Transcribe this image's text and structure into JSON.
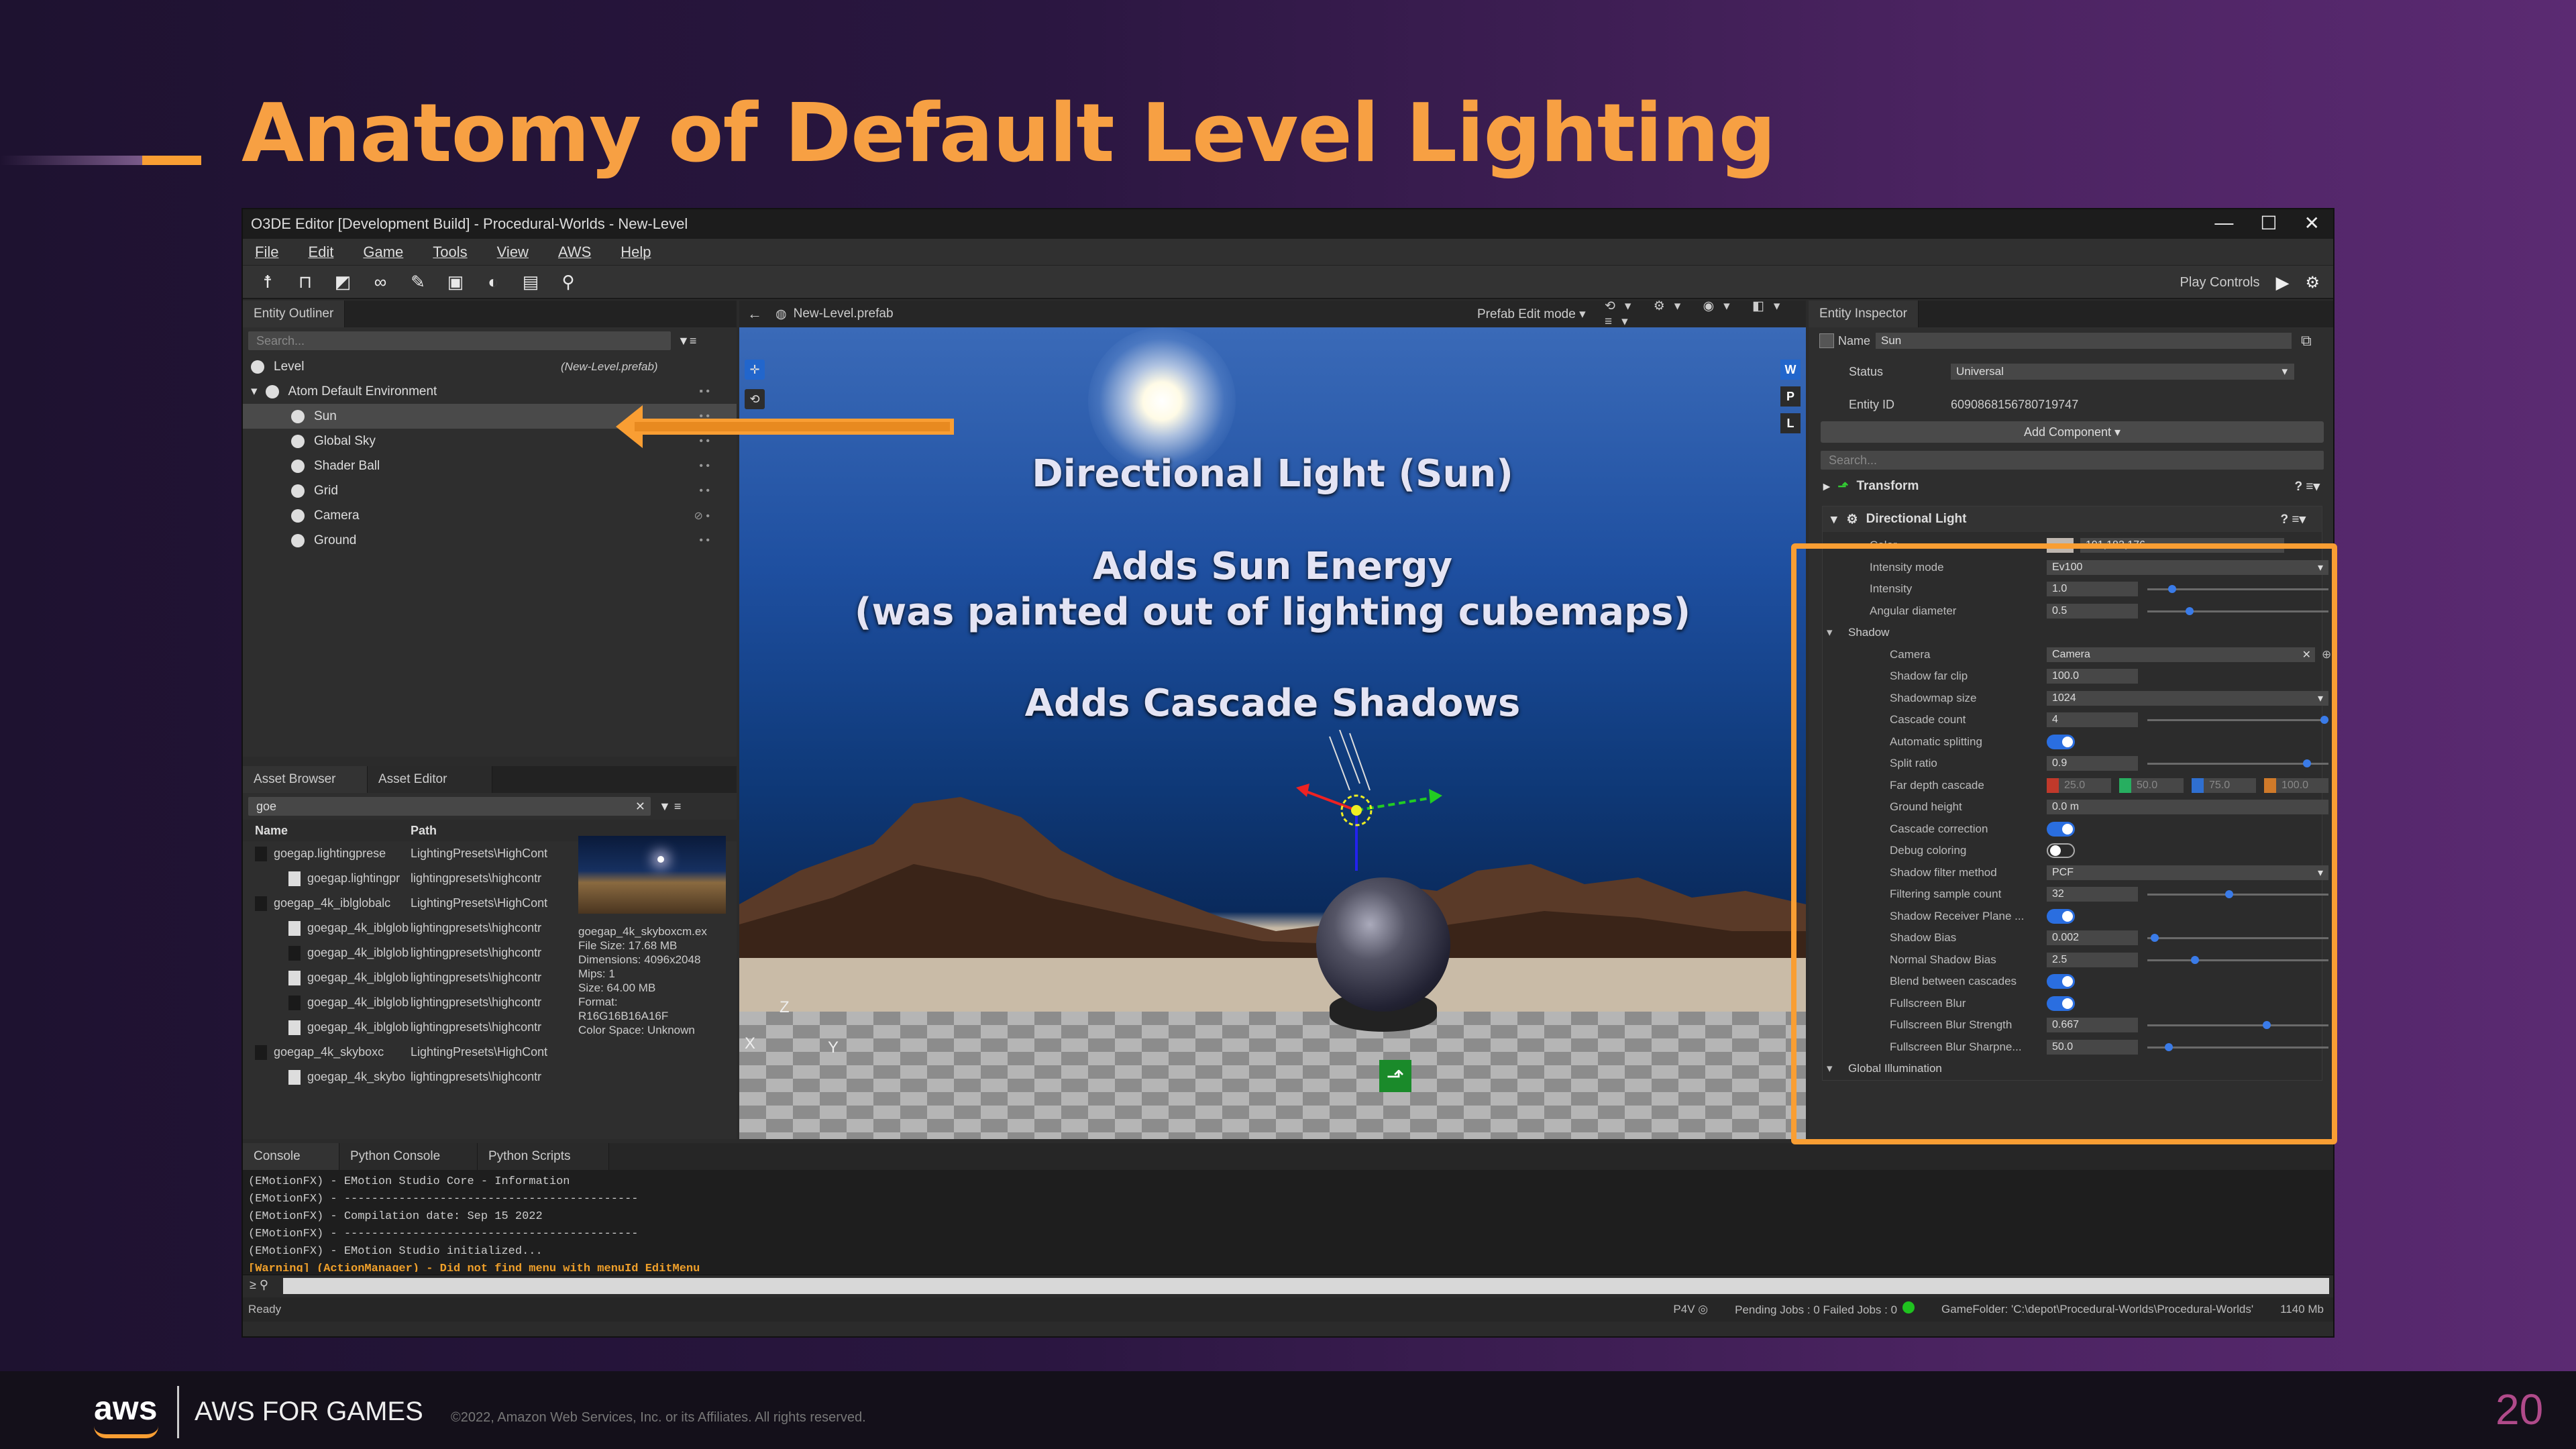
{
  "slide": {
    "title": "Anatomy of Default Level Lighting",
    "footer_brand": "aws",
    "footer_text": "AWS FOR GAMES",
    "copyright": "©2022, Amazon Web Services, Inc. or its Affiliates. All rights reserved.",
    "page_number": "20",
    "accent_color": "#f99e33"
  },
  "window": {
    "title": "O3DE Editor [Development Build] - Procedural-Worlds - New-Level",
    "controls": [
      "—",
      "☐",
      "✕"
    ]
  },
  "menu": [
    "File",
    "Edit",
    "Game",
    "Tools",
    "View",
    "AWS",
    "Help"
  ],
  "toolbar": {
    "play_controls_label": "Play Controls"
  },
  "outliner": {
    "tab": "Entity Outliner",
    "search_placeholder": "Search...",
    "level_label": "Level",
    "level_path": "(New-Level.prefab)",
    "env_label": "Atom Default Environment",
    "items": [
      "Sun",
      "Global Sky",
      "Shader Ball",
      "Grid",
      "Camera",
      "Ground"
    ]
  },
  "asset_browser": {
    "tabs": [
      "Asset Browser",
      "Asset Editor"
    ],
    "search_value": "goe",
    "col_name": "Name",
    "col_path": "Path",
    "rows": [
      {
        "name": "goegap.lightingprese",
        "path": "LightingPresets\\HighCont"
      },
      {
        "name": "goegap.lightingpr",
        "path": "lightingpresets\\highcontr"
      },
      {
        "name": "goegap_4k_iblglobalc",
        "path": "LightingPresets\\HighCont"
      },
      {
        "name": "goegap_4k_iblglob",
        "path": "lightingpresets\\highcontr"
      },
      {
        "name": "goegap_4k_iblglob",
        "path": "lightingpresets\\highcontr"
      },
      {
        "name": "goegap_4k_iblglob",
        "path": "lightingpresets\\highcontr"
      },
      {
        "name": "goegap_4k_iblglob",
        "path": "lightingpresets\\highcontr"
      },
      {
        "name": "goegap_4k_iblglob",
        "path": "lightingpresets\\highcontr"
      },
      {
        "name": "goegap_4k_skyboxc",
        "path": "LightingPresets\\HighCont"
      },
      {
        "name": "goegap_4k_skybo",
        "path": "lightingpresets\\highcontr"
      }
    ],
    "info": [
      "goegap_4k_skyboxcm.ex",
      "File Size: 17.68 MB",
      "Dimensions: 4096x2048",
      "Mips: 1",
      "Size: 64.00 MB",
      "Format:",
      "R16G16B16A16F",
      "Color Space: Unknown"
    ]
  },
  "viewport": {
    "tab": "New-Level.prefab",
    "mode": "Prefab Edit mode",
    "annotations": [
      "Directional Light (Sun)",
      "Adds Sun Energy",
      "(was painted out of lighting cubemaps)",
      "Adds Cascade Shadows"
    ],
    "side_right": [
      "W",
      "P",
      "L"
    ],
    "axis": {
      "z": "Z",
      "x": "X",
      "y": "Y"
    }
  },
  "inspector": {
    "tab": "Entity Inspector",
    "name_label": "Name",
    "name_value": "Sun",
    "status_label": "Status",
    "status_value": "Universal",
    "entity_id_label": "Entity ID",
    "entity_id_value": "6090868156780719747",
    "add_component": "Add Component ▾",
    "search_placeholder": "Search...",
    "transform_label": "Transform",
    "dl_label": "Directional Light",
    "color_value": "191,183,176",
    "fields": {
      "color": "Color",
      "intensity_mode": "Intensity mode",
      "intensity_mode_value": "Ev100",
      "intensity": "Intensity",
      "intensity_value": "1.0",
      "angular": "Angular diameter",
      "angular_value": "0.5",
      "shadow": "Shadow",
      "camera": "Camera",
      "camera_value": "Camera",
      "far_clip": "Shadow far clip",
      "far_clip_value": "100.0",
      "shadowmap_size": "Shadowmap size",
      "shadowmap_size_value": "1024",
      "cascade_count": "Cascade count",
      "cascade_count_value": "4",
      "auto_split": "Automatic splitting",
      "split_ratio": "Split ratio",
      "split_ratio_value": "0.9",
      "far_depth": "Far depth cascade",
      "far_depth_values": [
        "25.0",
        "50.0",
        "75.0",
        "100.0"
      ],
      "ground_height": "Ground height",
      "ground_height_value": "0.0 m",
      "cascade_correction": "Cascade correction",
      "debug_coloring": "Debug coloring",
      "filter_method": "Shadow filter method",
      "filter_method_value": "PCF",
      "filter_sample": "Filtering sample count",
      "filter_sample_value": "32",
      "receiver_plane": "Shadow Receiver Plane ...",
      "shadow_bias": "Shadow Bias",
      "shadow_bias_value": "0.002",
      "normal_bias": "Normal Shadow Bias",
      "normal_bias_value": "2.5",
      "blend_cascades": "Blend between cascades",
      "fullscreen_blur": "Fullscreen Blur",
      "blur_strength": "Fullscreen Blur Strength",
      "blur_strength_value": "0.667",
      "blur_sharpness": "Fullscreen Blur Sharpne...",
      "blur_sharpness_value": "50.0",
      "global_illum": "Global Illumination"
    }
  },
  "console": {
    "tabs": [
      "Console",
      "Python Console",
      "Python Scripts"
    ],
    "lines": [
      "(EMotionFX) - EMotion Studio Core - Information",
      "(EMotionFX) - -------------------------------------------",
      "(EMotionFX) - Compilation date: Sep 15 2022",
      "(EMotionFX) - -------------------------------------------",
      "(EMotionFX) - EMotion Studio initialized..."
    ],
    "warning": "[Warning] (ActionManager) - Did not find menu with menuId EditMenu"
  },
  "status": {
    "left": "Ready",
    "p4v": "P4V",
    "jobs": "Pending Jobs : 0  Failed Jobs : 0",
    "game_folder": "GameFolder: 'C:\\depot\\Procedural-Worlds\\Procedural-Worlds'",
    "memory": "1140 Mb"
  }
}
